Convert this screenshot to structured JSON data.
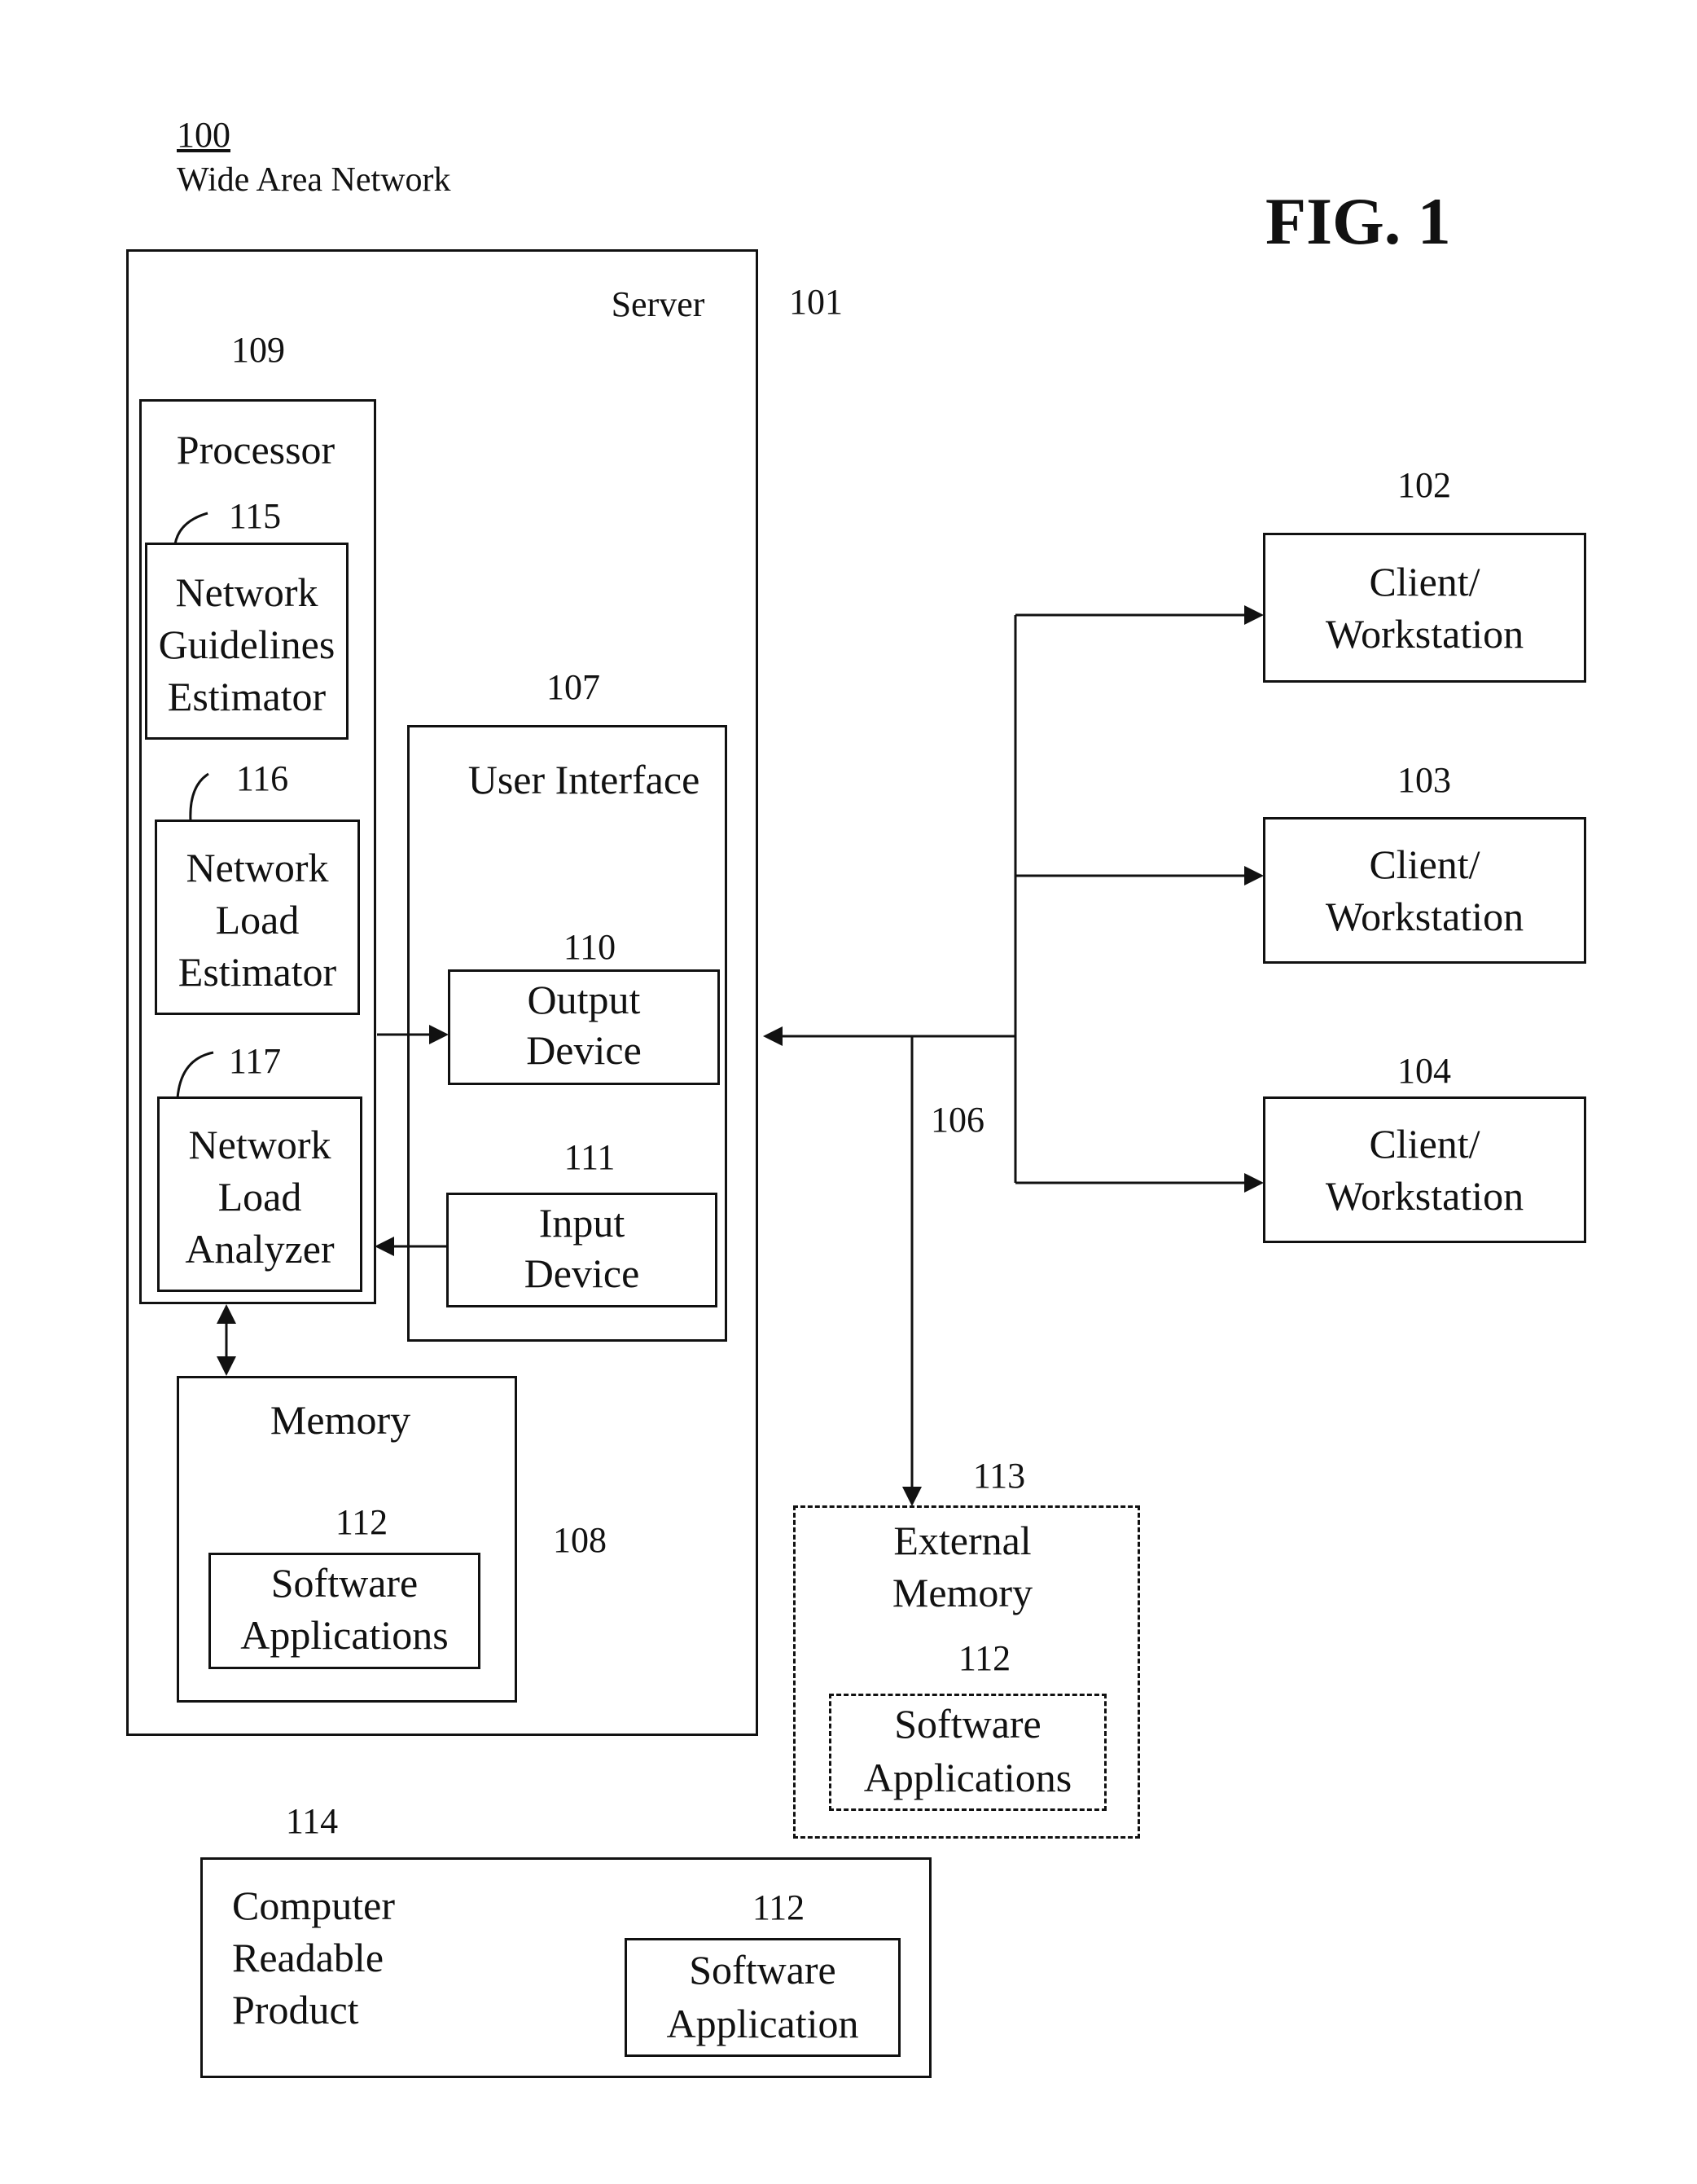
{
  "header": {
    "ref_number": "100",
    "network_name": "Wide Area Network",
    "figure_label": "FIG. 1"
  },
  "server": {
    "label": "Server",
    "ref": "101",
    "processor": {
      "ref": "109",
      "label": "Processor",
      "modules": [
        {
          "ref": "115",
          "lines": [
            "Network",
            "Guidelines",
            "Estimator"
          ]
        },
        {
          "ref": "116",
          "lines": [
            "Network",
            "Load",
            "Estimator"
          ]
        },
        {
          "ref": "117",
          "lines": [
            "Network",
            "Load",
            "Analyzer"
          ]
        }
      ]
    },
    "user_interface": {
      "ref": "107",
      "label": "User Interface",
      "output_device": {
        "ref": "110",
        "lines": [
          "Output",
          "Device"
        ]
      },
      "input_device": {
        "ref": "111",
        "lines": [
          "Input",
          "Device"
        ]
      }
    },
    "memory": {
      "ref": "108",
      "label": "Memory",
      "software": {
        "ref": "112",
        "lines": [
          "Software",
          "Applications"
        ]
      }
    }
  },
  "network": {
    "ref": "106"
  },
  "clients": [
    {
      "ref": "102",
      "lines": [
        "Client/",
        "Workstation"
      ]
    },
    {
      "ref": "103",
      "lines": [
        "Client/",
        "Workstation"
      ]
    },
    {
      "ref": "104",
      "lines": [
        "Client/",
        "Workstation"
      ]
    }
  ],
  "external_memory": {
    "ref": "113",
    "lines": [
      "External",
      "Memory"
    ],
    "software": {
      "ref": "112",
      "lines": [
        "Software",
        "Applications"
      ]
    }
  },
  "computer_readable_product": {
    "ref": "114",
    "lines": [
      "Computer",
      "Readable",
      "Product"
    ],
    "software": {
      "ref": "112",
      "lines": [
        "Software",
        "Application"
      ]
    }
  }
}
